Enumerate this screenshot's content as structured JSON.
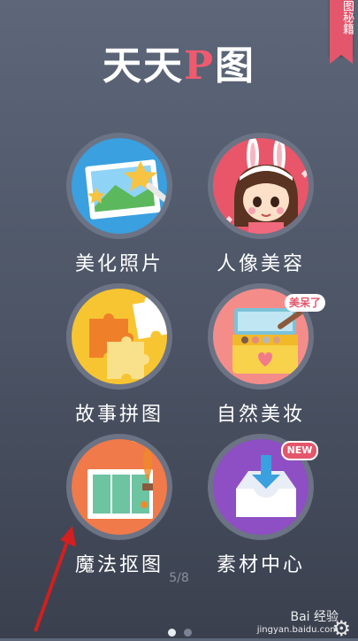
{
  "ribbon": {
    "text": "图秘籍"
  },
  "app_title": {
    "part1": "天天",
    "part2": "P",
    "part3": "图"
  },
  "tiles": [
    {
      "label": "美化照片"
    },
    {
      "label": "人像美容"
    },
    {
      "label": "故事拼图"
    },
    {
      "label": "自然美妆",
      "badge": "美呆了"
    },
    {
      "label": "魔法抠图"
    },
    {
      "label": "素材中心",
      "badge": "NEW"
    }
  ],
  "page_indicator": "5/8",
  "watermark": {
    "brand": "Bai 经验",
    "url": "jingyan.baidu.com"
  },
  "colors": {
    "accent": "#f05a6e",
    "dot_active": "#e8ecf2",
    "dot_inactive": "#7a8294"
  }
}
